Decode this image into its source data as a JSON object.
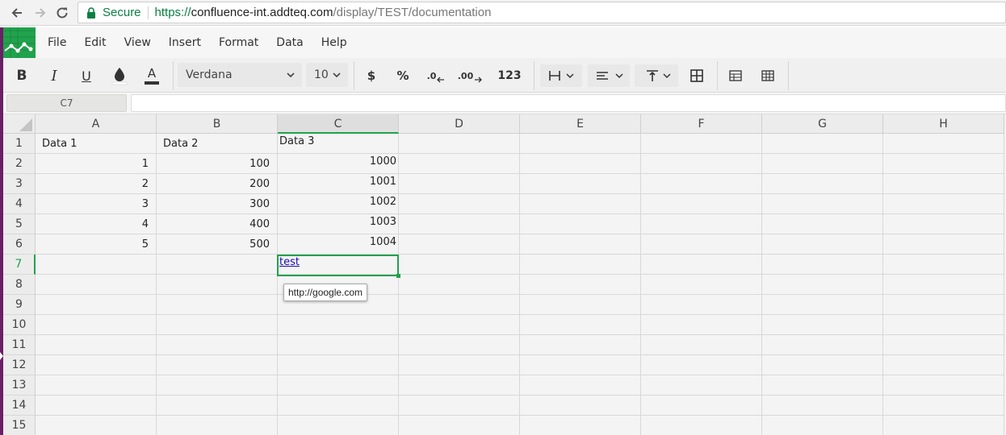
{
  "browser": {
    "secure_label": "Secure",
    "url_scheme": "https://",
    "url_host": "confluence-int.addteq.com",
    "url_path": "/display/TEST/documentation",
    "icons": [
      "back-arrow-icon",
      "forward-arrow-icon",
      "reload-icon",
      "lock-icon"
    ]
  },
  "menu": {
    "logo_icon": "sheet-chart-logo-icon",
    "items": [
      "File",
      "Edit",
      "View",
      "Insert",
      "Format",
      "Data",
      "Help"
    ]
  },
  "toolbar": {
    "bold": "B",
    "italic": "I",
    "underline": "U",
    "font_color": "A",
    "font_family": "Verdana",
    "font_size": "10",
    "currency": "$",
    "percent": "%",
    "decimal_decrease": ".0",
    "decimal_increase": ".00",
    "number_format": "123",
    "icons": [
      "fill-color-icon",
      "border-icon",
      "align-left-icon",
      "vertical-align-icon",
      "merge-cells-icon",
      "freeze-rows-icon",
      "freeze-columns-icon"
    ]
  },
  "formula_bar": {
    "cell_ref": "C7",
    "value": ""
  },
  "sheet": {
    "columns": [
      "A",
      "B",
      "C",
      "D",
      "E",
      "F",
      "G",
      "H"
    ],
    "rows": [
      "1",
      "2",
      "3",
      "4",
      "5",
      "6",
      "7",
      "8",
      "9",
      "10",
      "11",
      "12",
      "13",
      "14",
      "15"
    ],
    "active_column": "C",
    "active_row": "7",
    "cells": {
      "A1": "Data 1",
      "B1": "Data 2",
      "C1": "Data 3",
      "A2": "1",
      "B2": "100",
      "C2": "1000",
      "A3": "2",
      "B3": "200",
      "C3": "1001",
      "A4": "3",
      "B4": "300",
      "C4": "1002",
      "A5": "4",
      "B5": "400",
      "C5": "1003",
      "A6": "5",
      "B6": "500",
      "C6": "1004",
      "C7": "test"
    },
    "link_tooltip": "http://google.com"
  },
  "colors": {
    "accent": "#21a24d",
    "left_strip": "#6b1f66",
    "secure": "#0b8043",
    "link": "#1a0dab"
  }
}
